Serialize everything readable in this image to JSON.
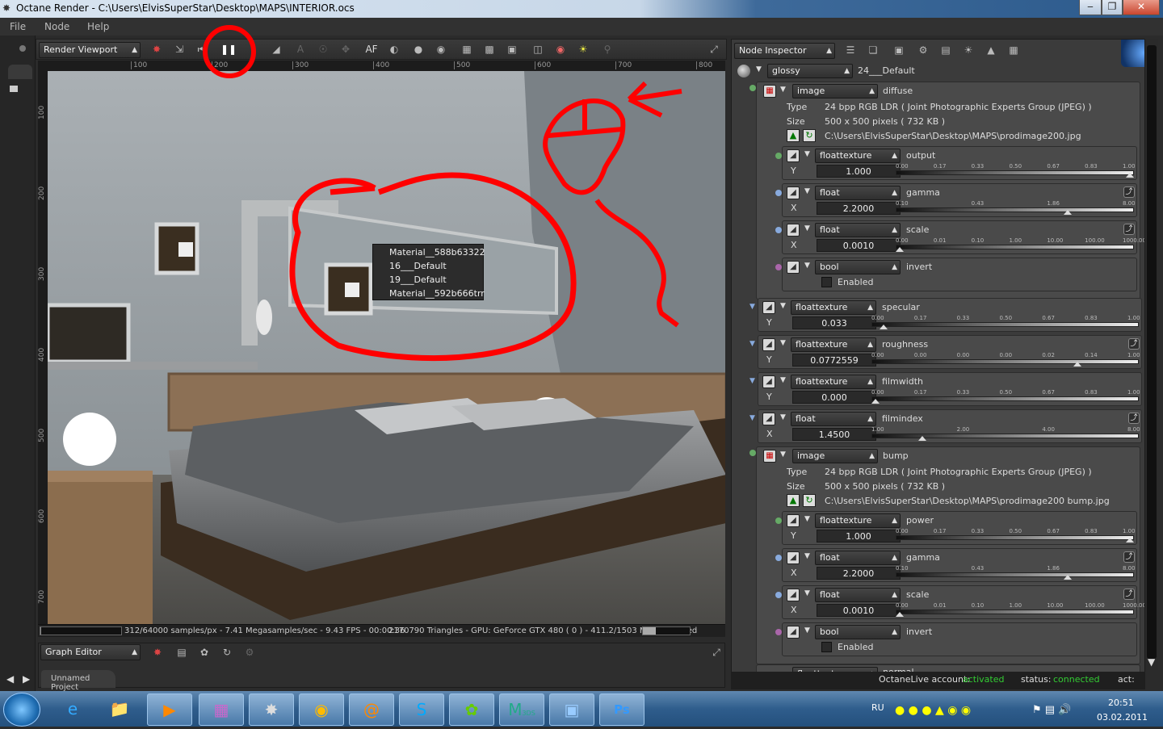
{
  "window": {
    "title": "Octane Render - C:\\Users\\ElvisSuperStar\\Desktop\\MAPS\\INTERIOR.ocs",
    "minimize": "‒",
    "maximize": "❐",
    "close": "✕"
  },
  "menu": [
    "File",
    "Node",
    "Help"
  ],
  "viewport": {
    "panel_select": "Render Viewport",
    "toolbar_af": "AF",
    "ruler_ticks": [
      "100",
      "200",
      "300",
      "400",
      "500",
      "600",
      "700",
      "800",
      "900"
    ],
    "vruler_ticks": [
      "100",
      "200",
      "300",
      "400",
      "500",
      "600",
      "700"
    ],
    "status_left": "312/64000 samples/px - 7.41 Megasamples/sec - 9.43 FPS - 00:00:36",
    "status_right": "2170790 Triangles - GPU: GeForce GTX 480 ( 0 ) - 411.2/1503 MB Mem Used",
    "render_progress": 0.005
  },
  "context_menu": [
    "Material__588b63322",
    "16___Default",
    "19___Default",
    "Material__592b666trr"
  ],
  "graph_editor": {
    "select": "Graph Editor",
    "tab": "Unnamed Project"
  },
  "inspector": {
    "select": "Node Inspector",
    "root": {
      "type": "glossy",
      "name": "24___Default"
    },
    "diffuse": {
      "type": "image",
      "name": "diffuse",
      "type_label": "Type",
      "type_value": "24 bpp RGB LDR ( Joint Photographic Experts Group (JPEG) )",
      "size_label": "Size",
      "size_value": "500 x 500 pixels ( 732 KB )",
      "path": "C:\\Users\\ElvisSuperStar\\Desktop\\MAPS\\prodimage200.jpg"
    },
    "diffuse_children": [
      {
        "type": "floattexture",
        "name": "output",
        "axis": "Y",
        "value": "1.000",
        "ticks": [
          "0.00",
          "0.17",
          "0.33",
          "0.50",
          "0.67",
          "0.83",
          "1.00"
        ],
        "level": 1.0
      },
      {
        "type": "float",
        "name": "gamma",
        "axis": "X",
        "value": "2.2000",
        "ticks": [
          "0.10",
          "0.43",
          "1.86",
          "8.00"
        ],
        "level": 0.73
      },
      {
        "type": "float",
        "name": "scale",
        "axis": "X",
        "value": "0.0010",
        "ticks": [
          "0.00",
          "0.01",
          "0.10",
          "1.00",
          "10.00",
          "100.00",
          "1000.00"
        ],
        "level": 0.0
      },
      {
        "type": "bool",
        "name": "invert",
        "check": "Enabled"
      }
    ],
    "params": [
      {
        "type": "floattexture",
        "name": "specular",
        "axis": "Y",
        "value": "0.033",
        "ticks": [
          "0.00",
          "0.17",
          "0.33",
          "0.50",
          "0.67",
          "0.83",
          "1.00"
        ],
        "level": 0.03
      },
      {
        "type": "floattexture",
        "name": "roughness",
        "axis": "Y",
        "value": "0.0772559",
        "ticks": [
          "0.00",
          "0.00",
          "0.00",
          "0.00",
          "0.02",
          "0.14",
          "1.00"
        ],
        "level": 0.78
      },
      {
        "type": "floattexture",
        "name": "filmwidth",
        "axis": "Y",
        "value": "0.000",
        "ticks": [
          "0.00",
          "0.17",
          "0.33",
          "0.50",
          "0.67",
          "0.83",
          "1.00"
        ],
        "level": 0.0
      },
      {
        "type": "float",
        "name": "filmindex",
        "axis": "X",
        "value": "1.4500",
        "ticks": [
          "1.00",
          "2.00",
          "4.00",
          "8.00"
        ],
        "level": 0.18
      }
    ],
    "bump": {
      "type": "image",
      "name": "bump",
      "type_label": "Type",
      "type_value": "24 bpp RGB LDR ( Joint Photographic Experts Group (JPEG) )",
      "size_label": "Size",
      "size_value": "500 x 500 pixels ( 732 KB )",
      "path": "C:\\Users\\ElvisSuperStar\\Desktop\\MAPS\\prodimage200 bump.jpg"
    },
    "bump_children": [
      {
        "type": "floattexture",
        "name": "power",
        "axis": "Y",
        "value": "1.000",
        "ticks": [
          "0.00",
          "0.17",
          "0.33",
          "0.50",
          "0.67",
          "0.83",
          "1.00"
        ],
        "level": 1.0
      },
      {
        "type": "float",
        "name": "gamma",
        "axis": "X",
        "value": "2.2000",
        "ticks": [
          "0.10",
          "0.43",
          "1.86",
          "8.00"
        ],
        "level": 0.73
      },
      {
        "type": "float",
        "name": "scale",
        "axis": "X",
        "value": "0.0010",
        "ticks": [
          "0.00",
          "0.01",
          "0.10",
          "1.00",
          "10.00",
          "100.00",
          "1000.00"
        ],
        "level": 0.0
      },
      {
        "type": "bool",
        "name": "invert",
        "check": "Enabled"
      }
    ],
    "cut_off": {
      "type": "floattexture",
      "name": "normal"
    }
  },
  "live": {
    "account_label": "OctaneLive account:",
    "account_value": "activated",
    "status_label": "status:",
    "status_value": "connected",
    "act_label": "act:"
  },
  "taskbar": {
    "lang": "RU",
    "time": "20:51",
    "date": "03.02.2011",
    "apps": [
      "ie",
      "explorer",
      "media",
      "winrar",
      "octane",
      "chrome",
      "mail",
      "skype",
      "icq",
      "3dsmax",
      "image-viewer",
      "photoshop"
    ],
    "ps_label": "Ps",
    "max_label": "3DS"
  },
  "colors": {
    "accent_green": "#33cc33",
    "annotation_red": "#ff0000"
  }
}
